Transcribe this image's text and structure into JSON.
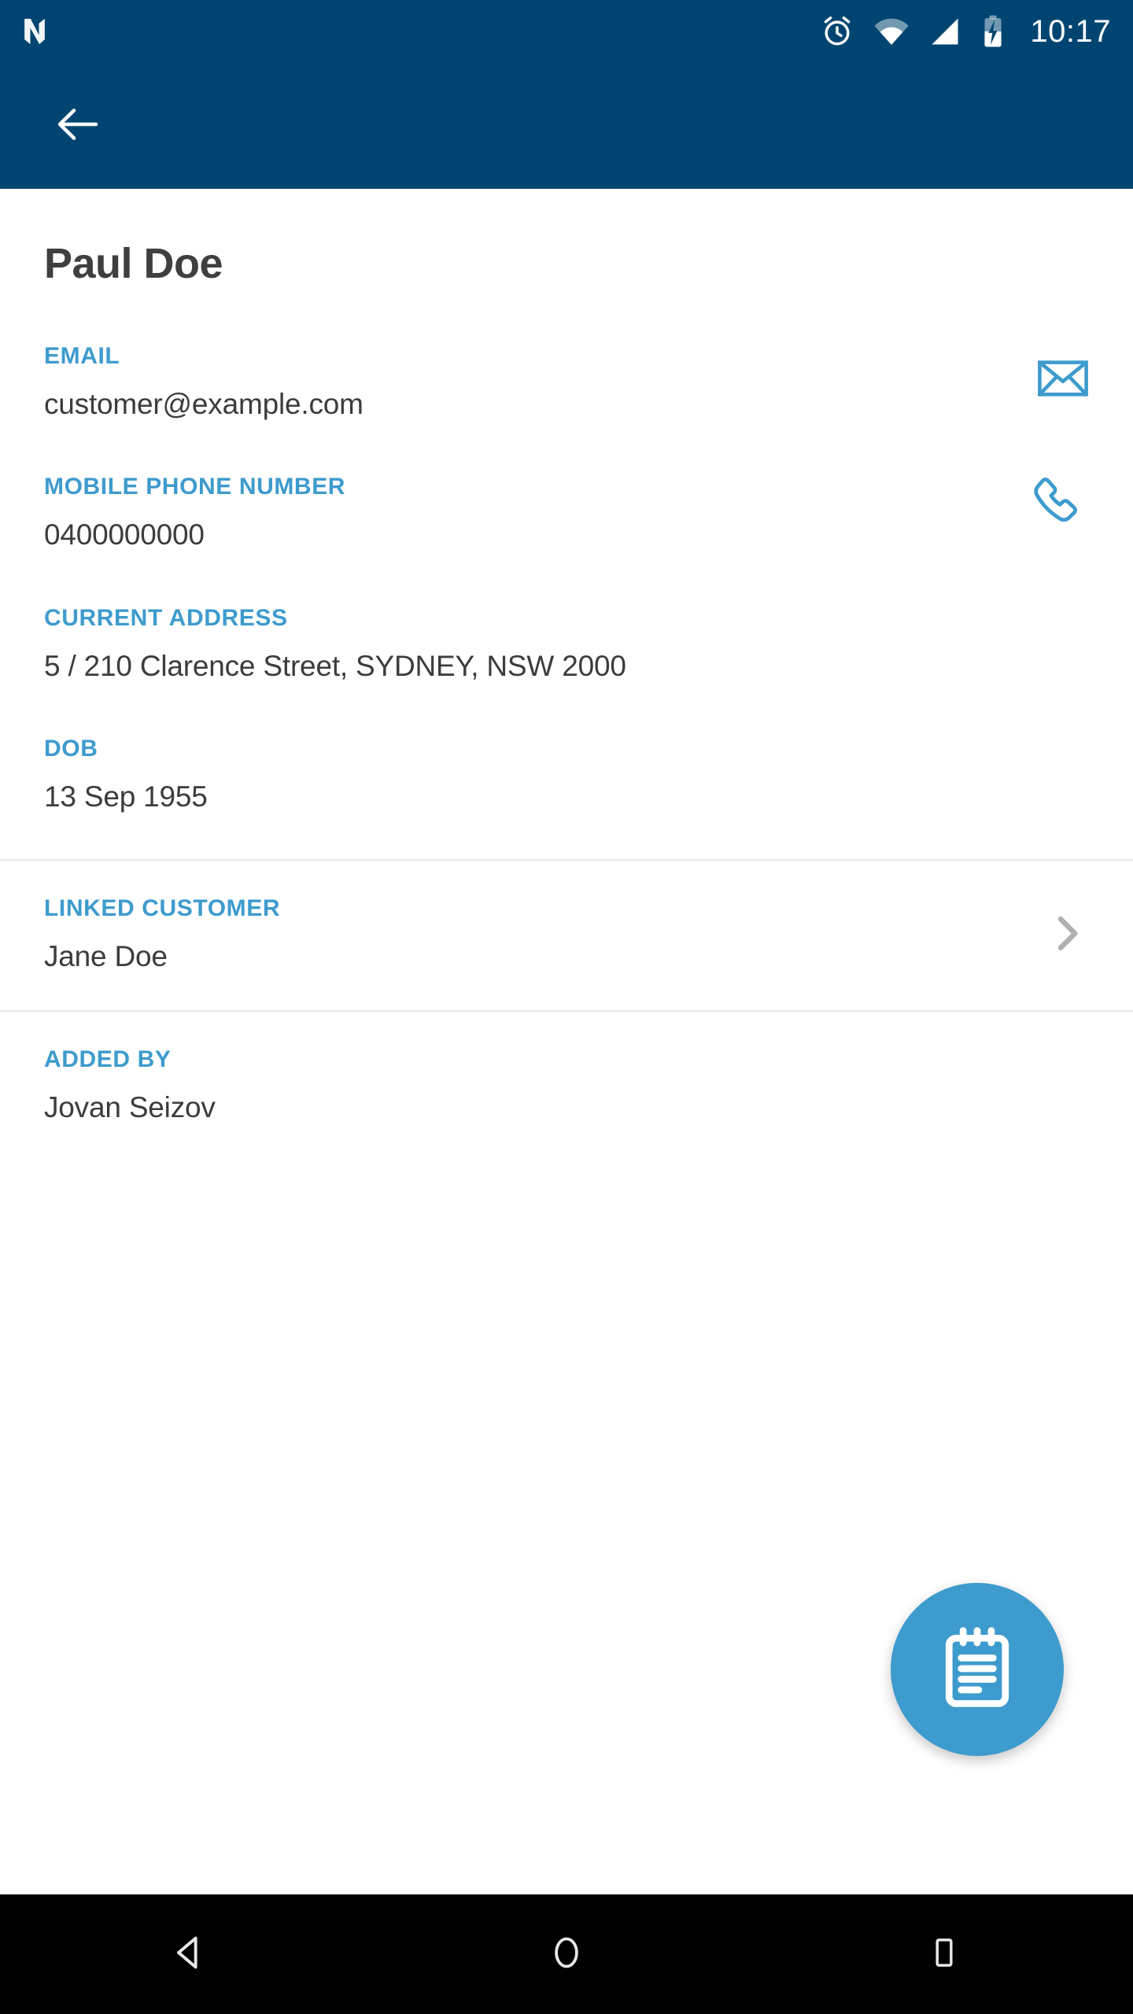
{
  "status_bar": {
    "notification_icon": "app-logo-n-icon",
    "icons": [
      "alarm-icon",
      "wifi-icon",
      "cell-signal-icon",
      "battery-charging-icon"
    ],
    "time": "10:17"
  },
  "app_bar": {
    "back_icon": "arrow-left-icon",
    "background_color": "#004571"
  },
  "page": {
    "title": "Paul Doe"
  },
  "fields": [
    {
      "label": "EMAIL",
      "value": "customer@example.com",
      "action_icon": "envelope-icon"
    },
    {
      "label": "MOBILE PHONE NUMBER",
      "value": "0400000000",
      "action_icon": "phone-icon"
    },
    {
      "label": "CURRENT ADDRESS",
      "value": "5 / 210 Clarence Street, SYDNEY, NSW 2000",
      "action_icon": ""
    },
    {
      "label": "DOB",
      "value": "13 Sep 1955",
      "action_icon": ""
    }
  ],
  "linked_customer": {
    "label": "LINKED CUSTOMER",
    "value": "Jane Doe",
    "chevron_icon": "chevron-right-icon"
  },
  "added_by": {
    "label": "ADDED BY",
    "value": "Jovan Seizov"
  },
  "fab": {
    "icon": "notepad-icon",
    "color": "#3e9bcd"
  },
  "nav_bar": {
    "back_icon": "nav-back-triangle-icon",
    "home_icon": "nav-home-circle-icon",
    "recents_icon": "nav-recents-square-icon"
  },
  "colors": {
    "header": "#004571",
    "accent": "#3e9bcd",
    "text": "#3c3c3c",
    "title": "#3f3f3f",
    "divider": "#e8e8e8",
    "chevron": "#b0b0b0"
  }
}
